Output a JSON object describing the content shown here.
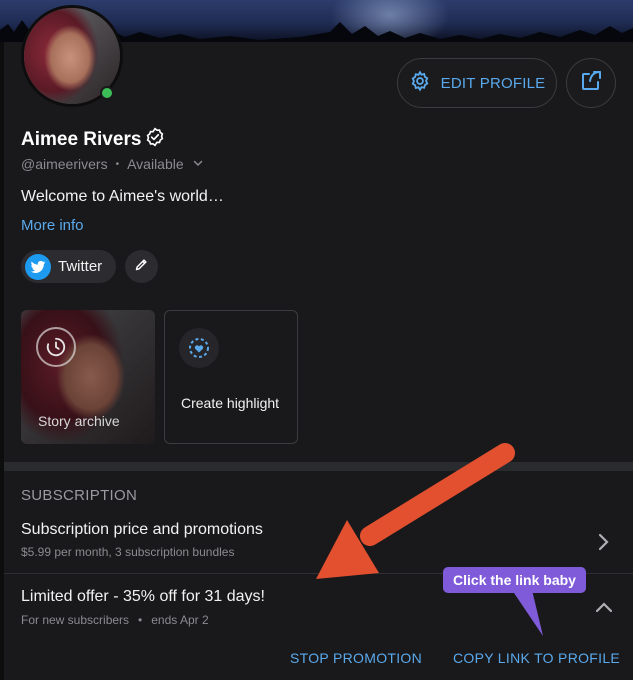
{
  "profile": {
    "name": "Aimee Rivers",
    "handle": "@aimeerivers",
    "status": "Available",
    "bio": "Welcome to Aimee's world…",
    "more_info": "More info",
    "edit_label": "EDIT PROFILE",
    "online_color": "#3cbf57"
  },
  "social": {
    "twitter_label": "Twitter"
  },
  "highlights": {
    "archive_label": "Story archive",
    "create_label": "Create highlight"
  },
  "subscription": {
    "section_title": "SUBSCRIPTION",
    "price_title": "Subscription price and promotions",
    "price_sub": "$5.99 per month, 3 subscription bundles",
    "offer_title": "Limited offer - 35% off for 31 days!",
    "offer_audience": "For new subscribers",
    "offer_ends": "ends Apr 2",
    "stop_label": "STOP PROMOTION",
    "copy_label": "COPY LINK TO PROFILE"
  },
  "annotation": {
    "tooltip_text": "Click the link baby",
    "arrow_color": "#e2502f",
    "tooltip_color": "#7f5bd9"
  },
  "colors": {
    "accent": "#5aa9ec",
    "twitter": "#1d9bf0",
    "background": "#19191b"
  },
  "icons": [
    "gear-icon",
    "share-icon",
    "verified-icon",
    "chevron-down-icon",
    "twitter-icon",
    "pencil-icon",
    "clock-icon",
    "heart-icon",
    "chevron-right-icon",
    "chevron-up-icon"
  ]
}
